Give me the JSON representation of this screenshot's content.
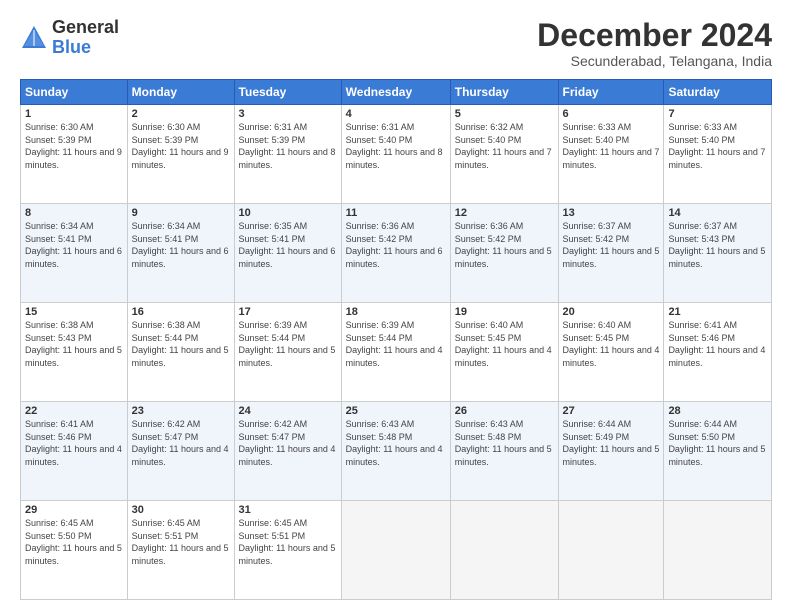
{
  "logo": {
    "general": "General",
    "blue": "Blue"
  },
  "title": "December 2024",
  "location": "Secunderabad, Telangana, India",
  "days_of_week": [
    "Sunday",
    "Monday",
    "Tuesday",
    "Wednesday",
    "Thursday",
    "Friday",
    "Saturday"
  ],
  "weeks": [
    [
      {
        "day": 1,
        "sunrise": "6:30 AM",
        "sunset": "5:39 PM",
        "daylight": "11 hours and 9 minutes."
      },
      {
        "day": 2,
        "sunrise": "6:30 AM",
        "sunset": "5:39 PM",
        "daylight": "11 hours and 9 minutes."
      },
      {
        "day": 3,
        "sunrise": "6:31 AM",
        "sunset": "5:39 PM",
        "daylight": "11 hours and 8 minutes."
      },
      {
        "day": 4,
        "sunrise": "6:31 AM",
        "sunset": "5:40 PM",
        "daylight": "11 hours and 8 minutes."
      },
      {
        "day": 5,
        "sunrise": "6:32 AM",
        "sunset": "5:40 PM",
        "daylight": "11 hours and 7 minutes."
      },
      {
        "day": 6,
        "sunrise": "6:33 AM",
        "sunset": "5:40 PM",
        "daylight": "11 hours and 7 minutes."
      },
      {
        "day": 7,
        "sunrise": "6:33 AM",
        "sunset": "5:40 PM",
        "daylight": "11 hours and 7 minutes."
      }
    ],
    [
      {
        "day": 8,
        "sunrise": "6:34 AM",
        "sunset": "5:41 PM",
        "daylight": "11 hours and 6 minutes."
      },
      {
        "day": 9,
        "sunrise": "6:34 AM",
        "sunset": "5:41 PM",
        "daylight": "11 hours and 6 minutes."
      },
      {
        "day": 10,
        "sunrise": "6:35 AM",
        "sunset": "5:41 PM",
        "daylight": "11 hours and 6 minutes."
      },
      {
        "day": 11,
        "sunrise": "6:36 AM",
        "sunset": "5:42 PM",
        "daylight": "11 hours and 6 minutes."
      },
      {
        "day": 12,
        "sunrise": "6:36 AM",
        "sunset": "5:42 PM",
        "daylight": "11 hours and 5 minutes."
      },
      {
        "day": 13,
        "sunrise": "6:37 AM",
        "sunset": "5:42 PM",
        "daylight": "11 hours and 5 minutes."
      },
      {
        "day": 14,
        "sunrise": "6:37 AM",
        "sunset": "5:43 PM",
        "daylight": "11 hours and 5 minutes."
      }
    ],
    [
      {
        "day": 15,
        "sunrise": "6:38 AM",
        "sunset": "5:43 PM",
        "daylight": "11 hours and 5 minutes."
      },
      {
        "day": 16,
        "sunrise": "6:38 AM",
        "sunset": "5:44 PM",
        "daylight": "11 hours and 5 minutes."
      },
      {
        "day": 17,
        "sunrise": "6:39 AM",
        "sunset": "5:44 PM",
        "daylight": "11 hours and 5 minutes."
      },
      {
        "day": 18,
        "sunrise": "6:39 AM",
        "sunset": "5:44 PM",
        "daylight": "11 hours and 4 minutes."
      },
      {
        "day": 19,
        "sunrise": "6:40 AM",
        "sunset": "5:45 PM",
        "daylight": "11 hours and 4 minutes."
      },
      {
        "day": 20,
        "sunrise": "6:40 AM",
        "sunset": "5:45 PM",
        "daylight": "11 hours and 4 minutes."
      },
      {
        "day": 21,
        "sunrise": "6:41 AM",
        "sunset": "5:46 PM",
        "daylight": "11 hours and 4 minutes."
      }
    ],
    [
      {
        "day": 22,
        "sunrise": "6:41 AM",
        "sunset": "5:46 PM",
        "daylight": "11 hours and 4 minutes."
      },
      {
        "day": 23,
        "sunrise": "6:42 AM",
        "sunset": "5:47 PM",
        "daylight": "11 hours and 4 minutes."
      },
      {
        "day": 24,
        "sunrise": "6:42 AM",
        "sunset": "5:47 PM",
        "daylight": "11 hours and 4 minutes."
      },
      {
        "day": 25,
        "sunrise": "6:43 AM",
        "sunset": "5:48 PM",
        "daylight": "11 hours and 4 minutes."
      },
      {
        "day": 26,
        "sunrise": "6:43 AM",
        "sunset": "5:48 PM",
        "daylight": "11 hours and 5 minutes."
      },
      {
        "day": 27,
        "sunrise": "6:44 AM",
        "sunset": "5:49 PM",
        "daylight": "11 hours and 5 minutes."
      },
      {
        "day": 28,
        "sunrise": "6:44 AM",
        "sunset": "5:50 PM",
        "daylight": "11 hours and 5 minutes."
      }
    ],
    [
      {
        "day": 29,
        "sunrise": "6:45 AM",
        "sunset": "5:50 PM",
        "daylight": "11 hours and 5 minutes."
      },
      {
        "day": 30,
        "sunrise": "6:45 AM",
        "sunset": "5:51 PM",
        "daylight": "11 hours and 5 minutes."
      },
      {
        "day": 31,
        "sunrise": "6:45 AM",
        "sunset": "5:51 PM",
        "daylight": "11 hours and 5 minutes."
      },
      null,
      null,
      null,
      null
    ]
  ]
}
